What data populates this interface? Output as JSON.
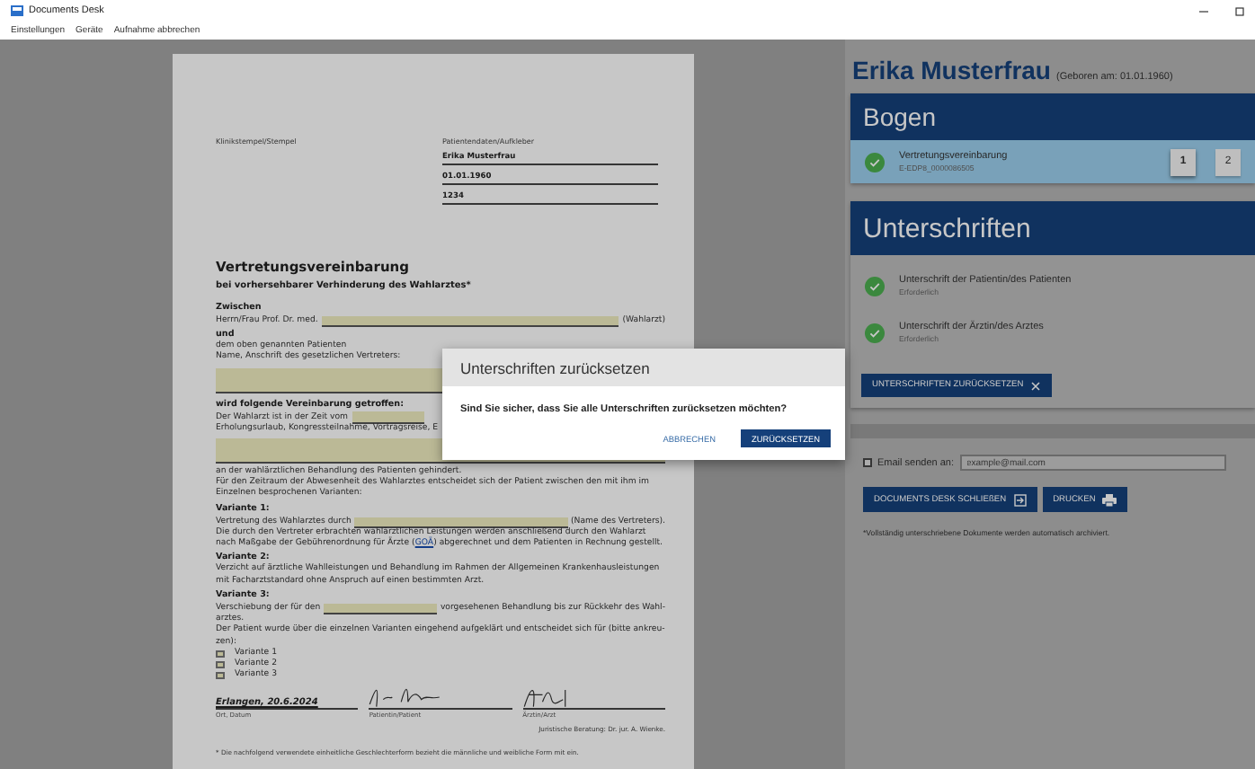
{
  "window": {
    "title": "Documents Desk"
  },
  "menu": [
    {
      "label": "Einstellungen"
    },
    {
      "label": "Geräte"
    },
    {
      "label": "Aufnahme abbrechen"
    }
  ],
  "document": {
    "stamp_label": "Klinikstempel/Stempel",
    "patient_label": "Patientendaten/Aufkleber",
    "patient_fields": [
      {
        "value": "Erika Musterfrau"
      },
      {
        "value": "01.01.1960"
      },
      {
        "value": "1234"
      }
    ],
    "title": "Vertretungsvereinbarung",
    "subtitle": "bei vorhersehbarer Verhinderung des Wahlarztes*",
    "blocks": [
      {
        "kind": "heading",
        "text": "Zwischen"
      },
      {
        "kind": "fillin",
        "before": "Herrn/Frau Prof. Dr. med.",
        "after": "(Wahlarzt)"
      },
      {
        "kind": "heading",
        "text": "und"
      },
      {
        "kind": "text",
        "text": "dem oben genannten Patienten"
      },
      {
        "kind": "text",
        "text": "Name, Anschrift des gesetzlichen Vertreters:"
      },
      {
        "kind": "bigfield"
      },
      {
        "kind": "heading",
        "text": "wird folgende Vereinbarung getroffen:"
      },
      {
        "kind": "fillin",
        "before": "Der Wahlarzt ist in der Zeit vom"
      },
      {
        "kind": "text",
        "text": "Erholungsurlaub, Kongressteilnahme, Vortragsreise, E"
      },
      {
        "kind": "bigfield"
      },
      {
        "kind": "text",
        "text": "an der wahlärztlichen Behandlung des Patienten gehindert."
      },
      {
        "kind": "text",
        "text": "Für den Zeitraum der Abwesenheit des Wahlarztes entscheidet sich der Patient zwischen den mit ihm im Einzelnen besprochenen Varianten:"
      },
      {
        "kind": "heading",
        "text": "Variante 1:"
      },
      {
        "kind": "fillin",
        "before": "Vertretung des Wahlarztes durch",
        "after": "(Name des Vertreters)."
      },
      {
        "kind": "link_text",
        "before": "Die durch den Vertreter erbrachten wahlärztlichen Leistungen werden anschließend durch den Wahlarzt nach Maßgabe der Gebührenordnung für Ärzte (",
        "link": "GOÄ",
        "after": ") abgerechnet und dem Patienten in Rechnung gestellt."
      },
      {
        "kind": "heading",
        "text": "Variante 2:"
      },
      {
        "kind": "text",
        "text": "Verzicht auf ärztliche Wahlleistungen und Behandlung im Rahmen der Allgemeinen Krankenhausleistungen mit Facharztstandard ohne Anspruch auf einen bestimmten Arzt."
      },
      {
        "kind": "heading",
        "text": "Variante 3:"
      },
      {
        "kind": "fillin",
        "before": "Verschiebung der für den",
        "after": "vorgesehenen Behandlung bis zur Rückkehr des Wahl-"
      },
      {
        "kind": "text",
        "text": "arztes."
      },
      {
        "kind": "text",
        "text": "Der Patient wurde über die einzelnen Varianten eingehend aufgeklärt und entscheidet sich für (bitte ankreu-"
      },
      {
        "kind": "text",
        "text": "zen):"
      }
    ],
    "options": [
      {
        "label": "Variante 1",
        "checked": false
      },
      {
        "label": "Variante 2",
        "checked": false
      },
      {
        "label": "Variante 3",
        "checked": false
      }
    ],
    "signatures": [
      {
        "kind": "text",
        "value": "Erlangen, 20.6.2024",
        "label": "Ort, Datum"
      },
      {
        "kind": "patient",
        "label": "Patientin/Patient"
      },
      {
        "kind": "doctor",
        "label": "Ärztin/Arzt"
      }
    ],
    "legal": "Juristische Beratung: Dr. jur. A. Wienke.",
    "footnote": "* Die nachfolgend verwendete einheitliche Geschlechterform bezieht die männliche und weibliche Form mit ein."
  },
  "patient": {
    "name": "Erika Musterfrau",
    "born": "(Geboren am: 01.01.1960)"
  },
  "bogen": {
    "title": "Bogen",
    "items": [
      {
        "title": "Vertretungsvereinbarung",
        "subtitle": "E-EDP8_0000086505",
        "done": true,
        "selected": true
      }
    ],
    "pages": [
      {
        "label": "1",
        "selected": true
      },
      {
        "label": "2",
        "selected": false
      }
    ]
  },
  "signatures": {
    "title": "Unterschriften",
    "items": [
      {
        "title": "Unterschrift der Patientin/des Patienten",
        "subtitle": "Erforderlich",
        "done": true
      },
      {
        "title": "Unterschrift der Ärztin/des Arztes",
        "subtitle": "Erforderlich",
        "done": true
      }
    ],
    "reset_button": "UNTERSCHRIFTEN ZURÜCKSETZEN"
  },
  "email": {
    "checked": false,
    "label": "Email senden an:",
    "placeholder": "example@mail.com"
  },
  "actions": [
    {
      "label": "DOCUMENTS DESK SCHLIEßEN",
      "kind": "exit"
    },
    {
      "label": "DRUCKEN",
      "kind": "print"
    }
  ],
  "note": "*Vollständig unterschriebene Dokumente werden automatisch archiviert.",
  "dialog": {
    "title": "Unterschriften zurücksetzen",
    "message": "Sind Sie sicher, dass Sie alle Unterschriften zurücksetzen möchten?",
    "buttons": [
      {
        "label": "ABBRECHEN",
        "kind": "text"
      },
      {
        "label": "ZURÜCKSETZEN",
        "kind": "primary"
      }
    ]
  }
}
